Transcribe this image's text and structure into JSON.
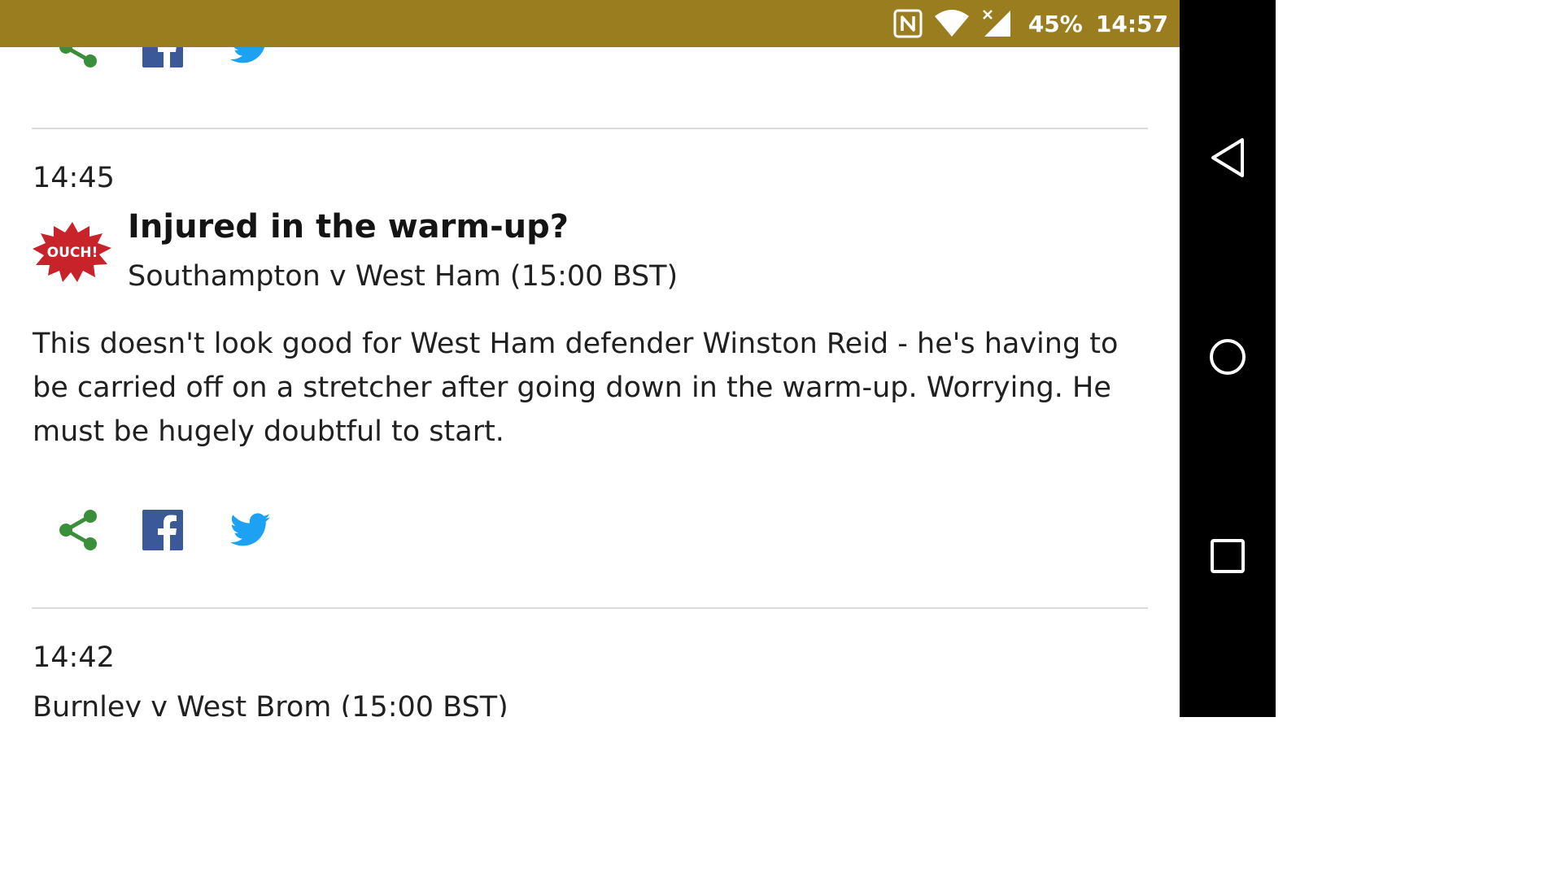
{
  "status_bar": {
    "battery": "45%",
    "time": "14:57",
    "background_color": "#997d1f",
    "icons": [
      "nfc-icon",
      "wifi-icon",
      "signal-icon"
    ]
  },
  "nav_bar": {
    "buttons": [
      "back-icon",
      "home-icon",
      "recents-icon"
    ]
  },
  "share": {
    "icons": [
      "share-icon",
      "facebook-icon",
      "twitter-icon"
    ],
    "share_color": "#3a8f3a",
    "facebook_color": "#3b5998",
    "twitter_color": "#1da1f2"
  },
  "posts": [
    {
      "time": "14:45",
      "badge": "OUCH!",
      "badge_color": "#c8222b",
      "title": "Injured in the warm-up?",
      "subtitle": "Southampton v West Ham (15:00 BST)",
      "body": "This doesn't look good for West Ham defender Winston Reid - he's having to be carried off on a stretcher after going down in the warm-up. Worrying. He must be hugely doubtful to start."
    },
    {
      "time": "14:42",
      "subtitle": "Burnley v West Brom (15:00 BST)"
    }
  ]
}
